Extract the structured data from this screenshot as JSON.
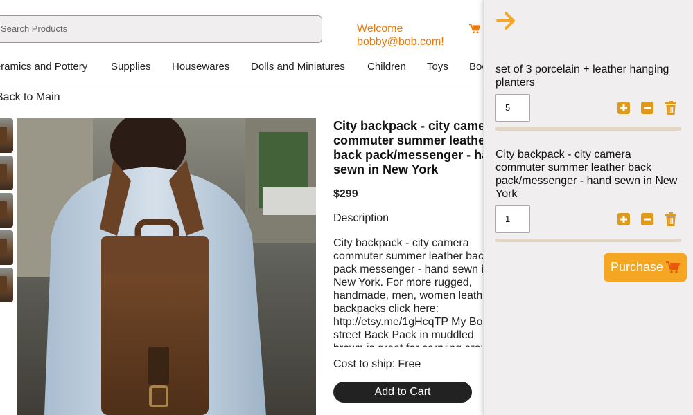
{
  "header": {
    "search_placeholder": "Search Products",
    "welcome_line1": "Welcome",
    "welcome_line2": "bobby@bob.com!",
    "cart_icon": "cart-icon"
  },
  "nav": {
    "items": [
      "Ceramics and Pottery",
      "Supplies",
      "Housewares",
      "Dolls and Miniatures",
      "Children",
      "Toys",
      "Books"
    ]
  },
  "back_link": "Back to Main",
  "product": {
    "title": "City backpack - city camera commuter summer leather back pack/messenger - hand sewn in New York",
    "price": "$299",
    "description_label": "Description",
    "description": "City backpack - city camera commuter summer leather back pack messenger - hand sewn in New York. For more rugged, handmade, men, women leather backpacks click here: http://etsy.me/1gHcqTP My Bond street Back Pack in muddled brown is great for carrying around portfolio, lap top in the city, or commuting",
    "shipping": "Cost to ship: Free",
    "add_to_cart": "Add to Cart"
  },
  "cart": {
    "close_icon": "arrow-right-icon",
    "items": [
      {
        "name": "set of 3 porcelain + leather hanging planters",
        "quantity": "5"
      },
      {
        "name": "City backpack - city camera commuter summer leather back pack/messenger - hand sewn in New York",
        "quantity": "1"
      }
    ],
    "purchase_label": "Purchase"
  },
  "colors": {
    "accent_orange": "#f07800",
    "purchase_bg": "#f5a623",
    "panel_bg": "#f0eeee",
    "dark_button": "#222222"
  }
}
